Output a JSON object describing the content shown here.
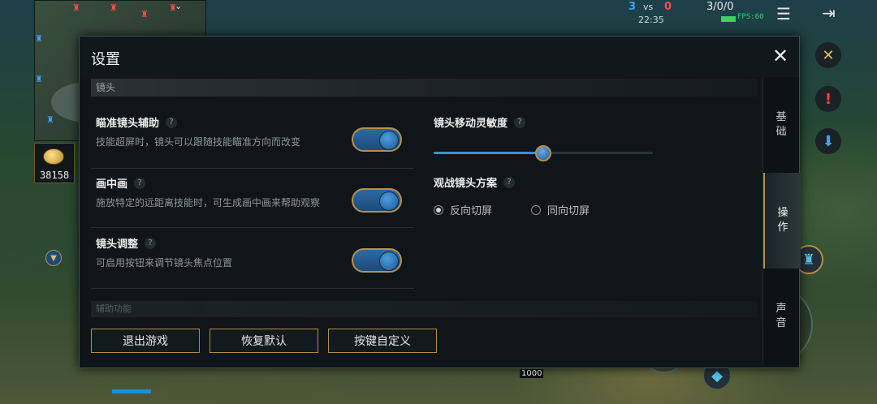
{
  "hud": {
    "score_blue": "3",
    "score_vs": "vs",
    "score_red": "0",
    "game_time": "22:35",
    "kda": "3/0/0",
    "fps": "FPS:60",
    "gold": "38158",
    "item_cost": "1000",
    "colors": {
      "blue": "#3ea0ff",
      "red": "#ff4b4b",
      "fps": "#3bd16a"
    }
  },
  "modal": {
    "title": "设置",
    "sections": {
      "camera": "镜头",
      "assist": "辅助功能"
    },
    "settings": [
      {
        "title": "瞄准镜头辅助",
        "desc": "技能超屏时，镜头可以跟随技能瞄准方向而改变",
        "enabled": true
      },
      {
        "title": "画中画",
        "desc": "施放特定的远距离技能时，可生成画中画来帮助观察",
        "enabled": true
      },
      {
        "title": "镜头调整",
        "desc": "可启用按钮来调节镜头焦点位置",
        "enabled": true
      }
    ],
    "sensitivity": {
      "title": "镜头移动灵敏度",
      "value_fraction": 0.5
    },
    "spectate": {
      "title": "观战镜头方案",
      "options": [
        {
          "label": "反向切屏",
          "selected": true
        },
        {
          "label": "同向切屏",
          "selected": false
        }
      ]
    },
    "help_glyph": "?",
    "buttons": {
      "exit": "退出游戏",
      "reset": "恢复默认",
      "keybind": "按键自定义"
    },
    "tabs": [
      {
        "label": "基\n础",
        "active": false
      },
      {
        "label": "操\n作",
        "active": true
      },
      {
        "label": "声\n音",
        "active": false
      }
    ],
    "accent": "#b7904b"
  }
}
